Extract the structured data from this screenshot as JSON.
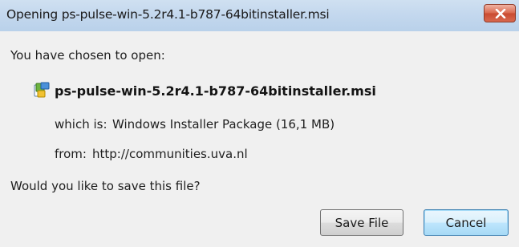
{
  "window": {
    "title": "Opening ps-pulse-win-5.2r4.1-b787-64bitinstaller.msi"
  },
  "dialog": {
    "intro": "You have chosen to open:",
    "file_icon": "msi-installer-icon",
    "filename": "ps-pulse-win-5.2r4.1-b787-64bitinstaller.msi",
    "which_is_label": "which is:",
    "which_is_value": "Windows Installer Package (16,1 MB)",
    "from_label": "from:",
    "from_value": "http://communities.uva.nl",
    "question": "Would you like to save this file?"
  },
  "buttons": {
    "save_label": "Save File",
    "cancel_label": "Cancel"
  },
  "colors": {
    "titlebar": "#c4d8ee",
    "close_button": "#d9664c",
    "background": "#f0f0f0",
    "default_button_border": "#3c7fb1"
  }
}
